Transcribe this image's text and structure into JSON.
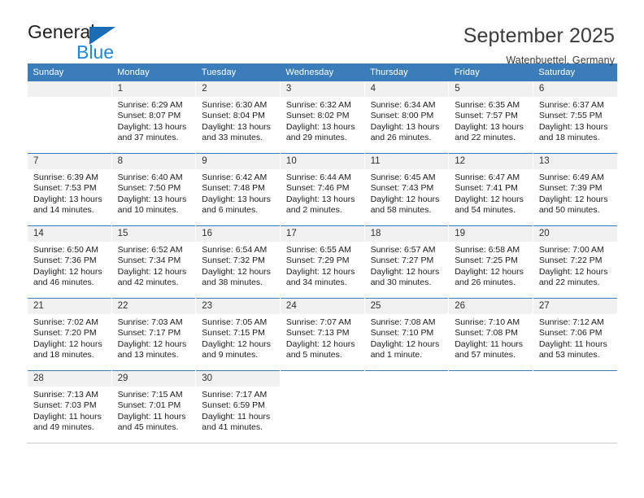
{
  "brand": {
    "name_part1": "General",
    "name_part2": "Blue",
    "triangle_color": "#1b6cb5",
    "blue_color": "#1f87d8"
  },
  "header": {
    "title": "September 2025",
    "subtitle": "Watenbuettel, Germany"
  },
  "theme": {
    "header_blue": "#3a7dba",
    "daynum_gray": "#f1f1f1"
  },
  "weekdays": [
    "Sunday",
    "Monday",
    "Tuesday",
    "Wednesday",
    "Thursday",
    "Friday",
    "Saturday"
  ],
  "weeks": [
    [
      {
        "day": "",
        "sunrise": "",
        "sunset": "",
        "daylight_line1": "",
        "daylight_line2": ""
      },
      {
        "day": "1",
        "sunrise": "Sunrise: 6:29 AM",
        "sunset": "Sunset: 8:07 PM",
        "daylight_line1": "Daylight: 13 hours",
        "daylight_line2": "and 37 minutes."
      },
      {
        "day": "2",
        "sunrise": "Sunrise: 6:30 AM",
        "sunset": "Sunset: 8:04 PM",
        "daylight_line1": "Daylight: 13 hours",
        "daylight_line2": "and 33 minutes."
      },
      {
        "day": "3",
        "sunrise": "Sunrise: 6:32 AM",
        "sunset": "Sunset: 8:02 PM",
        "daylight_line1": "Daylight: 13 hours",
        "daylight_line2": "and 29 minutes."
      },
      {
        "day": "4",
        "sunrise": "Sunrise: 6:34 AM",
        "sunset": "Sunset: 8:00 PM",
        "daylight_line1": "Daylight: 13 hours",
        "daylight_line2": "and 26 minutes."
      },
      {
        "day": "5",
        "sunrise": "Sunrise: 6:35 AM",
        "sunset": "Sunset: 7:57 PM",
        "daylight_line1": "Daylight: 13 hours",
        "daylight_line2": "and 22 minutes."
      },
      {
        "day": "6",
        "sunrise": "Sunrise: 6:37 AM",
        "sunset": "Sunset: 7:55 PM",
        "daylight_line1": "Daylight: 13 hours",
        "daylight_line2": "and 18 minutes."
      }
    ],
    [
      {
        "day": "7",
        "sunrise": "Sunrise: 6:39 AM",
        "sunset": "Sunset: 7:53 PM",
        "daylight_line1": "Daylight: 13 hours",
        "daylight_line2": "and 14 minutes."
      },
      {
        "day": "8",
        "sunrise": "Sunrise: 6:40 AM",
        "sunset": "Sunset: 7:50 PM",
        "daylight_line1": "Daylight: 13 hours",
        "daylight_line2": "and 10 minutes."
      },
      {
        "day": "9",
        "sunrise": "Sunrise: 6:42 AM",
        "sunset": "Sunset: 7:48 PM",
        "daylight_line1": "Daylight: 13 hours",
        "daylight_line2": "and 6 minutes."
      },
      {
        "day": "10",
        "sunrise": "Sunrise: 6:44 AM",
        "sunset": "Sunset: 7:46 PM",
        "daylight_line1": "Daylight: 13 hours",
        "daylight_line2": "and 2 minutes."
      },
      {
        "day": "11",
        "sunrise": "Sunrise: 6:45 AM",
        "sunset": "Sunset: 7:43 PM",
        "daylight_line1": "Daylight: 12 hours",
        "daylight_line2": "and 58 minutes."
      },
      {
        "day": "12",
        "sunrise": "Sunrise: 6:47 AM",
        "sunset": "Sunset: 7:41 PM",
        "daylight_line1": "Daylight: 12 hours",
        "daylight_line2": "and 54 minutes."
      },
      {
        "day": "13",
        "sunrise": "Sunrise: 6:49 AM",
        "sunset": "Sunset: 7:39 PM",
        "daylight_line1": "Daylight: 12 hours",
        "daylight_line2": "and 50 minutes."
      }
    ],
    [
      {
        "day": "14",
        "sunrise": "Sunrise: 6:50 AM",
        "sunset": "Sunset: 7:36 PM",
        "daylight_line1": "Daylight: 12 hours",
        "daylight_line2": "and 46 minutes."
      },
      {
        "day": "15",
        "sunrise": "Sunrise: 6:52 AM",
        "sunset": "Sunset: 7:34 PM",
        "daylight_line1": "Daylight: 12 hours",
        "daylight_line2": "and 42 minutes."
      },
      {
        "day": "16",
        "sunrise": "Sunrise: 6:54 AM",
        "sunset": "Sunset: 7:32 PM",
        "daylight_line1": "Daylight: 12 hours",
        "daylight_line2": "and 38 minutes."
      },
      {
        "day": "17",
        "sunrise": "Sunrise: 6:55 AM",
        "sunset": "Sunset: 7:29 PM",
        "daylight_line1": "Daylight: 12 hours",
        "daylight_line2": "and 34 minutes."
      },
      {
        "day": "18",
        "sunrise": "Sunrise: 6:57 AM",
        "sunset": "Sunset: 7:27 PM",
        "daylight_line1": "Daylight: 12 hours",
        "daylight_line2": "and 30 minutes."
      },
      {
        "day": "19",
        "sunrise": "Sunrise: 6:58 AM",
        "sunset": "Sunset: 7:25 PM",
        "daylight_line1": "Daylight: 12 hours",
        "daylight_line2": "and 26 minutes."
      },
      {
        "day": "20",
        "sunrise": "Sunrise: 7:00 AM",
        "sunset": "Sunset: 7:22 PM",
        "daylight_line1": "Daylight: 12 hours",
        "daylight_line2": "and 22 minutes."
      }
    ],
    [
      {
        "day": "21",
        "sunrise": "Sunrise: 7:02 AM",
        "sunset": "Sunset: 7:20 PM",
        "daylight_line1": "Daylight: 12 hours",
        "daylight_line2": "and 18 minutes."
      },
      {
        "day": "22",
        "sunrise": "Sunrise: 7:03 AM",
        "sunset": "Sunset: 7:17 PM",
        "daylight_line1": "Daylight: 12 hours",
        "daylight_line2": "and 13 minutes."
      },
      {
        "day": "23",
        "sunrise": "Sunrise: 7:05 AM",
        "sunset": "Sunset: 7:15 PM",
        "daylight_line1": "Daylight: 12 hours",
        "daylight_line2": "and 9 minutes."
      },
      {
        "day": "24",
        "sunrise": "Sunrise: 7:07 AM",
        "sunset": "Sunset: 7:13 PM",
        "daylight_line1": "Daylight: 12 hours",
        "daylight_line2": "and 5 minutes."
      },
      {
        "day": "25",
        "sunrise": "Sunrise: 7:08 AM",
        "sunset": "Sunset: 7:10 PM",
        "daylight_line1": "Daylight: 12 hours",
        "daylight_line2": "and 1 minute."
      },
      {
        "day": "26",
        "sunrise": "Sunrise: 7:10 AM",
        "sunset": "Sunset: 7:08 PM",
        "daylight_line1": "Daylight: 11 hours",
        "daylight_line2": "and 57 minutes."
      },
      {
        "day": "27",
        "sunrise": "Sunrise: 7:12 AM",
        "sunset": "Sunset: 7:06 PM",
        "daylight_line1": "Daylight: 11 hours",
        "daylight_line2": "and 53 minutes."
      }
    ],
    [
      {
        "day": "28",
        "sunrise": "Sunrise: 7:13 AM",
        "sunset": "Sunset: 7:03 PM",
        "daylight_line1": "Daylight: 11 hours",
        "daylight_line2": "and 49 minutes."
      },
      {
        "day": "29",
        "sunrise": "Sunrise: 7:15 AM",
        "sunset": "Sunset: 7:01 PM",
        "daylight_line1": "Daylight: 11 hours",
        "daylight_line2": "and 45 minutes."
      },
      {
        "day": "30",
        "sunrise": "Sunrise: 7:17 AM",
        "sunset": "Sunset: 6:59 PM",
        "daylight_line1": "Daylight: 11 hours",
        "daylight_line2": "and 41 minutes."
      },
      {
        "day": "",
        "sunrise": "",
        "sunset": "",
        "daylight_line1": "",
        "daylight_line2": ""
      },
      {
        "day": "",
        "sunrise": "",
        "sunset": "",
        "daylight_line1": "",
        "daylight_line2": ""
      },
      {
        "day": "",
        "sunrise": "",
        "sunset": "",
        "daylight_line1": "",
        "daylight_line2": ""
      },
      {
        "day": "",
        "sunrise": "",
        "sunset": "",
        "daylight_line1": "",
        "daylight_line2": ""
      }
    ]
  ]
}
